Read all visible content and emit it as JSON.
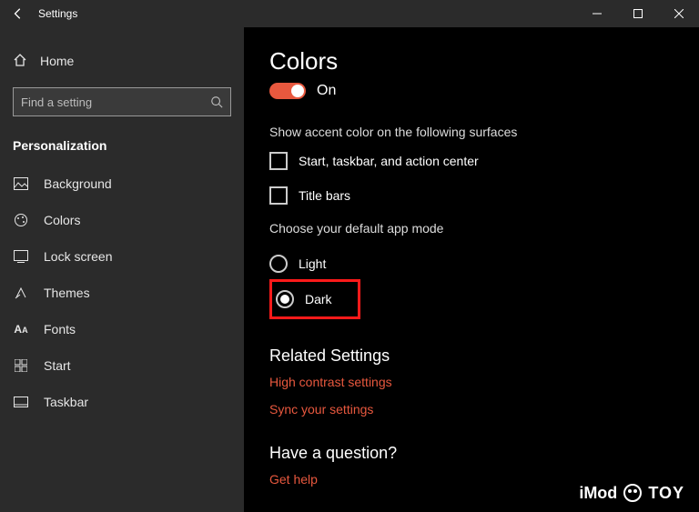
{
  "titlebar": {
    "title": "Settings"
  },
  "sidebar": {
    "home": "Home",
    "search_placeholder": "Find a setting",
    "category": "Personalization",
    "items": [
      {
        "label": "Background"
      },
      {
        "label": "Colors"
      },
      {
        "label": "Lock screen"
      },
      {
        "label": "Themes"
      },
      {
        "label": "Fonts"
      },
      {
        "label": "Start"
      },
      {
        "label": "Taskbar"
      }
    ]
  },
  "content": {
    "heading": "Colors",
    "toggle_label": "On",
    "accent_label": "Show accent color on the following surfaces",
    "cb1": "Start, taskbar, and action center",
    "cb2": "Title bars",
    "appmode_label": "Choose your default app mode",
    "radio_light": "Light",
    "radio_dark": "Dark",
    "related_heading": "Related Settings",
    "link_contrast": "High contrast settings",
    "link_sync": "Sync your settings",
    "question_heading": "Have a question?",
    "link_help": "Get help"
  },
  "watermark": {
    "a": "iMod",
    "b": "TOY"
  }
}
